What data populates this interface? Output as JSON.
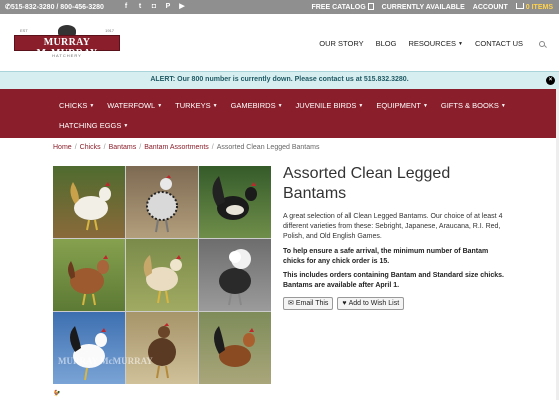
{
  "topbar": {
    "phones": "515-832-3280 / 800-456-3280",
    "social_icons": [
      "facebook-icon",
      "twitter-icon",
      "instagram-icon",
      "pinterest-icon",
      "youtube-icon"
    ],
    "free_catalog": "FREE CATALOG",
    "currently_available": "CURRENTLY AVAILABLE",
    "account": "ACCOUNT",
    "cart_count": "0 ITEMS"
  },
  "logo": {
    "name": "MURRAY McMURRAY",
    "est_left": "EST",
    "est_right": "1917",
    "sub": "HATCHERY"
  },
  "mainnav": {
    "items": [
      "OUR STORY",
      "BLOG",
      "RESOURCES",
      "CONTACT US"
    ]
  },
  "alert": {
    "message": "ALERT: Our 800 number is currently down. Please contact us at 515.832.3280.",
    "close": "×"
  },
  "catnav": {
    "row1": [
      "CHICKS",
      "WATERFOWL",
      "TURKEYS",
      "GAMEBIRDS",
      "JUVENILE BIRDS",
      "EQUIPMENT",
      "GIFTS & BOOKS"
    ],
    "row2": [
      "HATCHING EGGS"
    ]
  },
  "breadcrumb": {
    "items": [
      "Home",
      "Chicks",
      "Bantams",
      "Bantam Assortments",
      "Assorted Clean Legged Bantams"
    ],
    "separator": "/"
  },
  "product": {
    "title": "Assorted Clean Legged Bantams",
    "description": "A great selection of all Clean Legged Bantams. Our choice of at least 4 different varieties from these: Sebright, Japanese, Araucana, R.I. Red, Polish, and Old English Games.",
    "note1": "To help ensure a safe arrival, the minimum number of Bantam chicks for any chick order is 15.",
    "note2": "This includes orders containing Bantam and Standard size chicks. Bantams are available after April 1.",
    "email_label": "Email This",
    "wishlist_label": "Add to Wish List"
  },
  "image": {
    "watermark": "MURRAY McMURRAY"
  },
  "colors": {
    "brand": "#8a1f2b",
    "topbar": "#8f8f8f",
    "alert_bg": "#d7eef1",
    "cart_accent": "#ffd34d"
  }
}
